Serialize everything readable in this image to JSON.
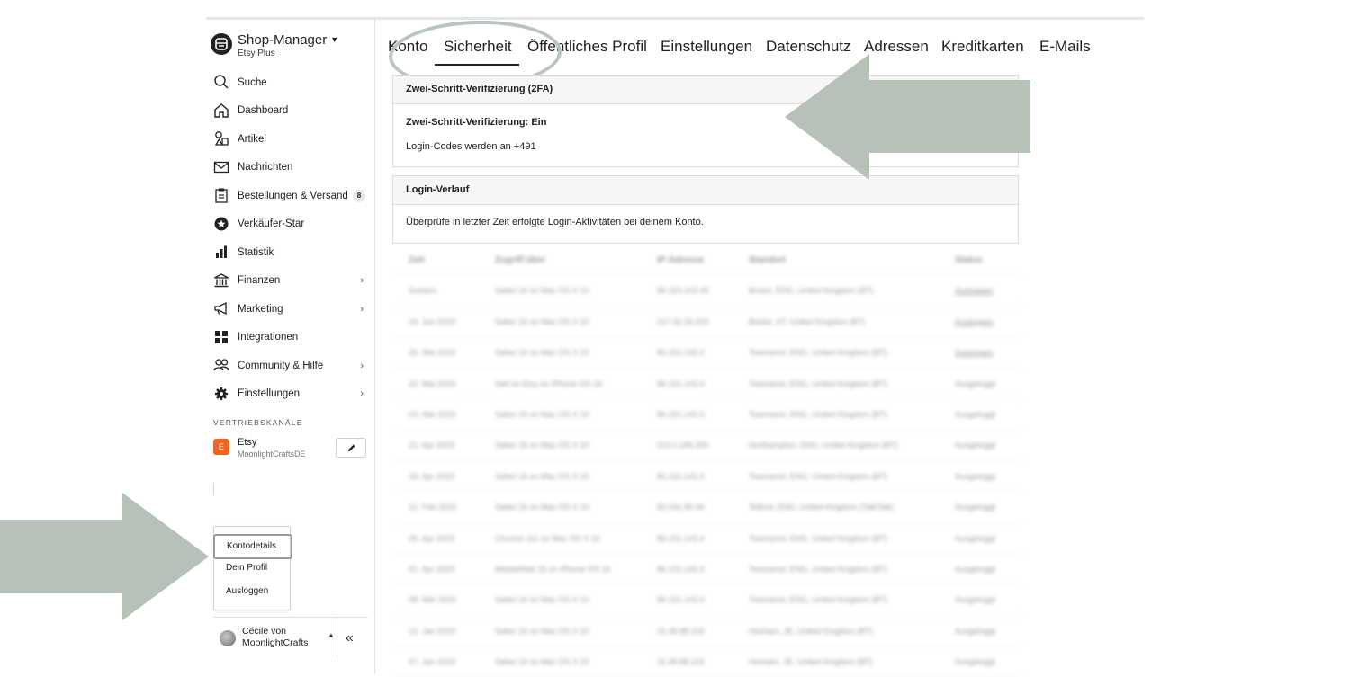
{
  "brand": {
    "title": "Shop-Manager",
    "subtitle": "Etsy Plus"
  },
  "nav": [
    {
      "label": "Suche"
    },
    {
      "label": "Dashboard"
    },
    {
      "label": "Artikel"
    },
    {
      "label": "Nachrichten"
    },
    {
      "label": "Bestellungen & Versand",
      "badge": "8"
    },
    {
      "label": "Verkäufer-Star"
    },
    {
      "label": "Statistik"
    },
    {
      "label": "Finanzen",
      "chevron": "›"
    },
    {
      "label": "Marketing",
      "chevron": "›"
    },
    {
      "label": "Integrationen"
    },
    {
      "label": "Community & Hilfe",
      "chevron": "›"
    },
    {
      "label": "Einstellungen",
      "chevron": "›"
    }
  ],
  "channels": {
    "section_label": "VERTRIEBSKANÄLE",
    "etsy": {
      "badge": "E",
      "name": "Etsy",
      "shop": "MoonlightCraftsDE"
    }
  },
  "account_menu": {
    "items": [
      "Kontodetails",
      "Dein Profil",
      "Ausloggen"
    ]
  },
  "user": {
    "name": "Cécile von MoonlightCrafts"
  },
  "tabs": [
    "Konto",
    "Sicherheit",
    "Öffentliches Profil",
    "Einstellungen",
    "Datenschutz",
    "Adressen",
    "Kreditkarten",
    "E-Mails"
  ],
  "two_fa": {
    "header": "Zwei-Schritt-Verifizierung (2FA)",
    "status": "Zwei-Schritt-Verifizierung: Ein",
    "codes": "Login-Codes werden an +491"
  },
  "login_history": {
    "header": "Login-Verlauf",
    "description": "Überprüfe in letzter Zeit erfolgte Login-Aktivitäten bei deinem Konto.",
    "columns": [
      "Zeit",
      "Zugriff über",
      "IP-Adresse",
      "Standort",
      "Status"
    ],
    "rows": [
      [
        "Soeben",
        "Safari 16 on Mac OS X 10",
        "86.163.103.45",
        "Bristol, ENG, United Kingdom (BT)",
        "Ausloggen"
      ],
      [
        "24. Jun 2023",
        "Safari 16 on Mac OS X 10",
        "217.42.26.203",
        "Bristol, ST, United Kingdom (BT)",
        "Ausloggen"
      ],
      [
        "25. Mai 2023",
        "Safari 16 on Mac OS X 10",
        "86.151.143.2",
        "Townsend, ENG, United Kingdom (BT)",
        "Ausloggen"
      ],
      [
        "22. Mai 2023",
        "Self on Etsy on iPhone OS 16",
        "86.151.143.3",
        "Townsend, ENG, United Kingdom (BT)",
        "Ausgeloggt"
      ],
      [
        "03. Mai 2023",
        "Safari 16 on Mac OS X 10",
        "86.151.143.3",
        "Townsend, ENG, United Kingdom (BT)",
        "Ausgeloggt"
      ],
      [
        "21. Apr 2023",
        "Safari 16 on Mac OS X 10",
        "213.1.246.250",
        "Northampton, ENG, United Kingdom (BT)",
        "Ausgeloggt"
      ],
      [
        "18. Apr 2023",
        "Safari 16 on Mac OS X 10",
        "86.151.143.3",
        "Townsend, ENG, United Kingdom (BT)",
        "Ausgeloggt"
      ],
      [
        "12. Feb 2023",
        "Safari 16 on Mac OS X 10",
        "82.241.90.34",
        "Telford, ENG, United Kingdom (TalkTalk)",
        "Ausgeloggt"
      ],
      [
        "05. Apr 2023",
        "Chrome 111 on Mac OS X 10",
        "86.151.143.4",
        "Townsend, ENG, United Kingdom (BT)",
        "Ausgeloggt"
      ],
      [
        "01. Apr 2023",
        "MobileWeb 15 on iPhone OS 16",
        "86.151.143.3",
        "Townsend, ENG, United Kingdom (BT)",
        "Ausgeloggt"
      ],
      [
        "08. Mär 2023",
        "Safari 16 on Mac OS X 10",
        "86.151.143.3",
        "Townsend, ENG, United Kingdom (BT)",
        "Ausgeloggt"
      ],
      [
        "12. Jan 2023",
        "Safari 16 on Mac OS X 10",
        "31.48.88.103",
        "Hexham, JE, United Kingdom (BT)",
        "Ausgeloggt"
      ],
      [
        "07. Jan 2023",
        "Safari 16 on Mac OS X 10",
        "31.48.88.103",
        "Hexham, JE, United Kingdom (BT)",
        "Ausgeloggt"
      ]
    ]
  },
  "colors": {
    "accent": "#222222",
    "annotation": "#b6c2b8",
    "etsy_orange": "#f1641e"
  }
}
